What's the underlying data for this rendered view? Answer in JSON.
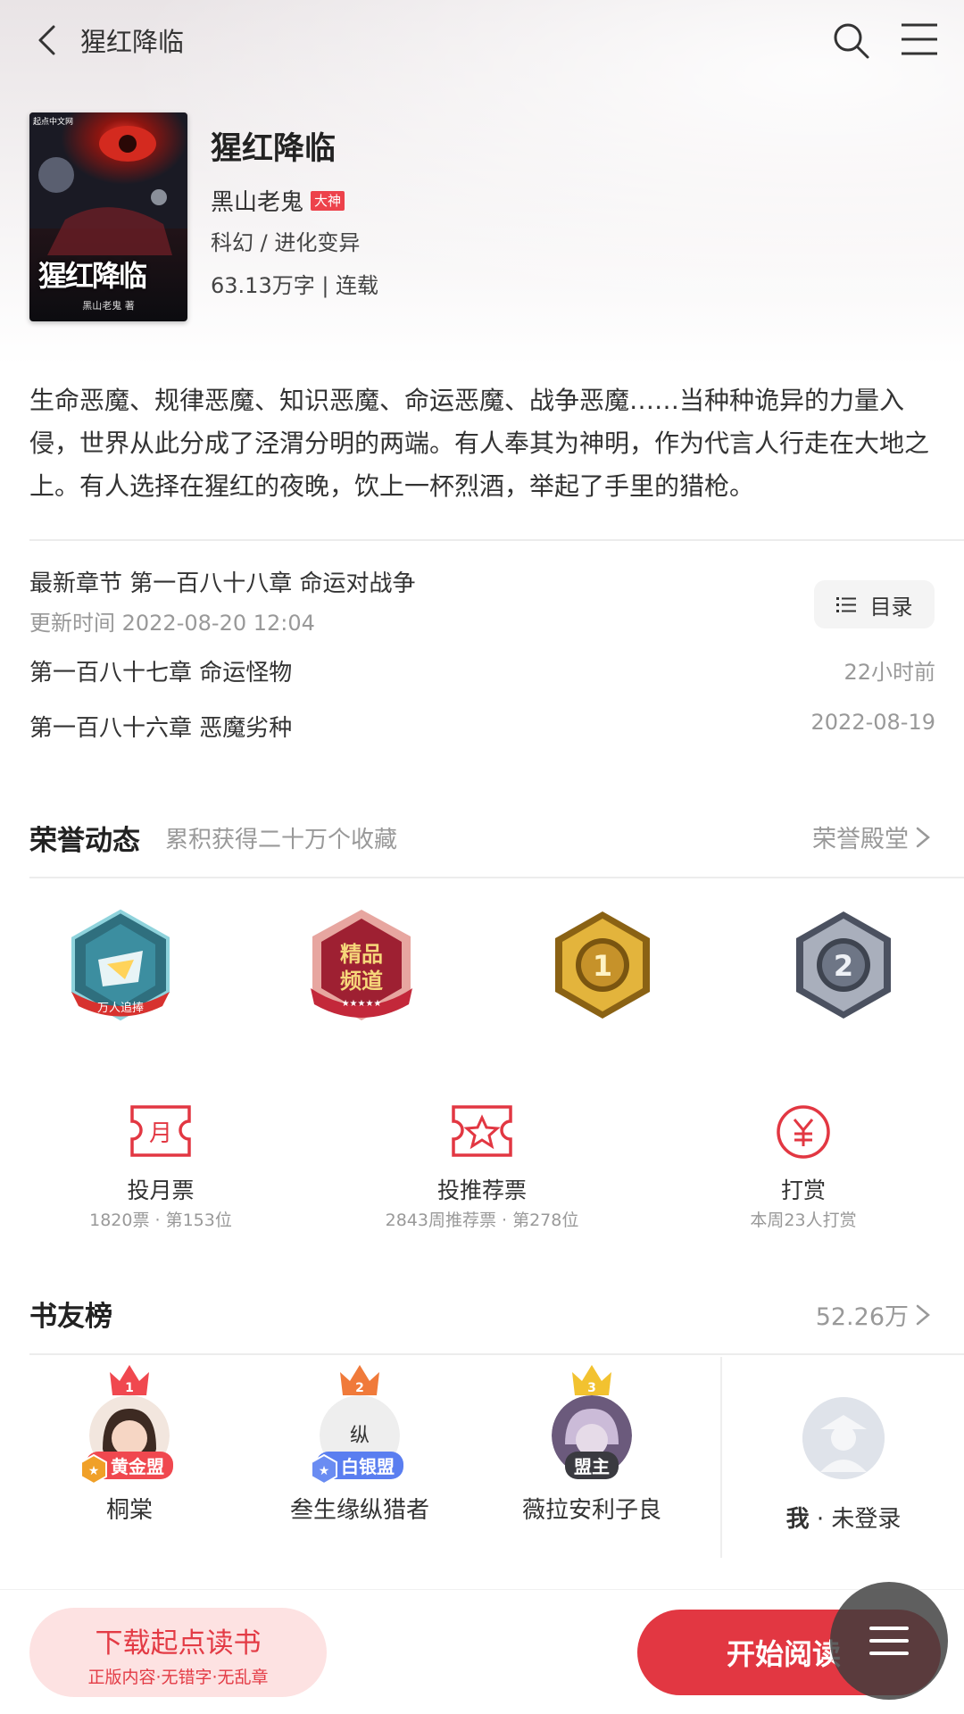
{
  "nav": {
    "title": "猩红降临"
  },
  "book": {
    "title": "猩红降临",
    "author": "黑山老鬼",
    "author_badge": "大神",
    "genre": "科幻 / 进化变异",
    "wordcount": "63.13万字 | 连载",
    "cover_text": "猩红降临",
    "cover_author": "黑山老鬼 著",
    "cover_publisher": "起点中文网"
  },
  "intro": "生命恶魔、规律恶魔、知识恶魔、命运恶魔、战争恶魔……当种种诡异的力量入侵，世界从此分成了泾渭分明的两端。有人奉其为神明，作为代言人行走在大地之上。有人选择在猩红的夜晚，饮上一杯烈酒，举起了手里的猎枪。",
  "chapters": {
    "latest": "最新章节 第一百八十八章 命运对战争",
    "update_time": "更新时间 2022-08-20 12:04",
    "catalog_label": "目录",
    "items": [
      {
        "title": "第一百八十七章 命运怪物",
        "time": "22小时前"
      },
      {
        "title": "第一百八十六章 恶魔劣种",
        "time": "2022-08-19"
      }
    ]
  },
  "honor": {
    "title": "荣誉动态",
    "subtitle": "累积获得二十万个收藏",
    "link": "荣誉殿堂",
    "badges": [
      {
        "name": "万人追捧",
        "text": "万人追捧"
      },
      {
        "name": "精品频道",
        "text": "精品频道"
      },
      {
        "name": "rank-1",
        "text": "1"
      },
      {
        "name": "rank-2",
        "text": "2"
      }
    ]
  },
  "votes": [
    {
      "label": "投月票",
      "sub": "1820票 · 第153位",
      "icon": "月"
    },
    {
      "label": "投推荐票",
      "sub": "2843周推荐票 · 第278位",
      "icon": "☆"
    },
    {
      "label": "打赏",
      "sub": "本周23人打赏",
      "icon": "￥"
    }
  ],
  "fans": {
    "title": "书友榜",
    "count": "52.26万",
    "list": [
      {
        "rank": "1",
        "name": "桐棠",
        "tag": "黄金盟",
        "color": "#f0484f"
      },
      {
        "rank": "2",
        "name": "叁生缘纵猎者",
        "tag": "白银盟",
        "color": "#f07a3a"
      },
      {
        "rank": "3",
        "name": "薇拉安利子良",
        "tag": "盟主",
        "color": "#f2c230"
      }
    ],
    "me_bold": "我",
    "me_rest": " · 未登录"
  },
  "bottom": {
    "download_title": "下载起点读书",
    "download_sub": "正版内容·无错字·无乱章",
    "read_label": "开始阅读"
  },
  "colors": {
    "accent": "#e23742",
    "gold": "#c8961e",
    "silver": "#6e7686"
  }
}
